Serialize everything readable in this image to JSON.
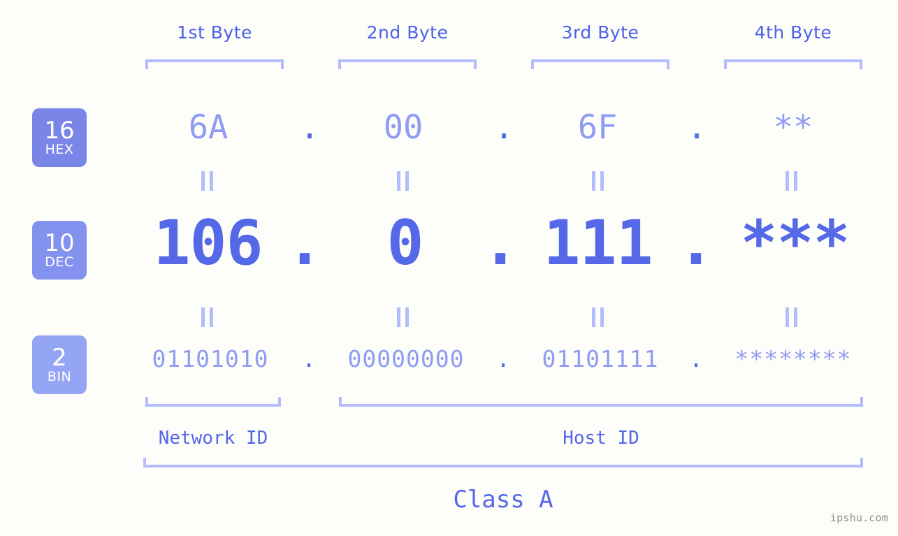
{
  "meta": {
    "background_color": "#fdfdfa",
    "accent_color": "#5468e8",
    "light_accent_color": "#8f9cf2",
    "bracket_color": "#b3bdfb",
    "watermark": "ipshu.com"
  },
  "byte_headers": [
    {
      "label": "1st Byte"
    },
    {
      "label": "2nd Byte"
    },
    {
      "label": "3rd Byte"
    },
    {
      "label": "4th Byte"
    }
  ],
  "bases": [
    {
      "number": "16",
      "name": "HEX",
      "color": "#7986e8"
    },
    {
      "number": "10",
      "name": "DEC",
      "color": "#8391ef"
    },
    {
      "number": "2",
      "name": "BIN",
      "color": "#93a5f4"
    }
  ],
  "rows": {
    "hex": {
      "base_number": "16",
      "base_name": "HEX",
      "values": [
        "6A",
        "00",
        "6F",
        "**"
      ],
      "separator": "."
    },
    "dec": {
      "base_number": "10",
      "base_name": "DEC",
      "values": [
        "106",
        "0",
        "111",
        "***"
      ],
      "separator": "."
    },
    "bin": {
      "base_number": "2",
      "base_name": "BIN",
      "values": [
        "01101010",
        "00000000",
        "01101111",
        "********"
      ],
      "separator": "."
    }
  },
  "equals_symbol": "||",
  "segments": {
    "network_id": "Network ID",
    "host_id": "Host ID",
    "class": "Class A"
  }
}
